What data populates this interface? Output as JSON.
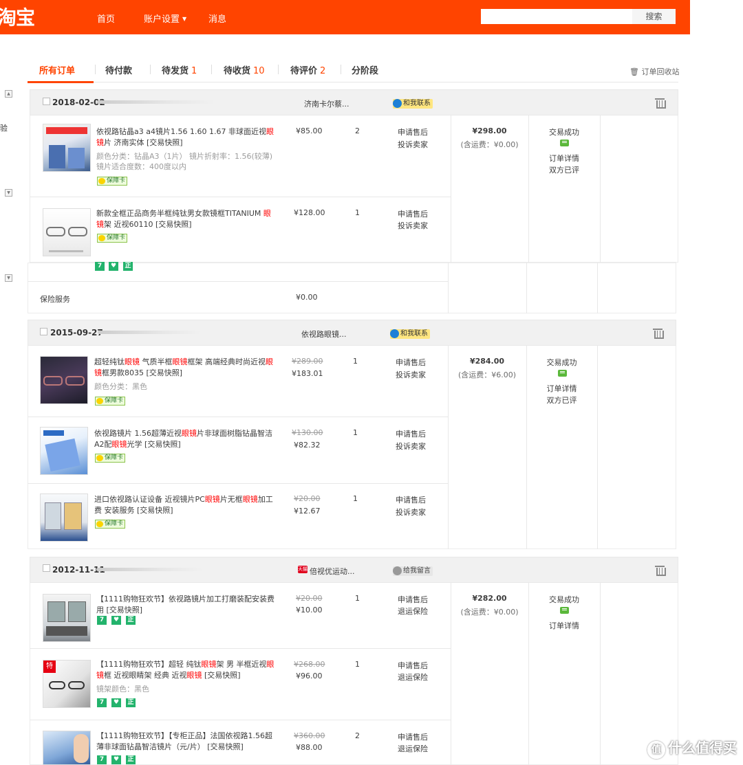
{
  "header": {
    "logo": "淘宝",
    "nav": [
      "首页",
      "账户设置",
      "消息"
    ],
    "search_placeholder": "",
    "search_button": "搜索"
  },
  "tabs": [
    {
      "label": "所有订单",
      "count": ""
    },
    {
      "label": "待付款",
      "count": ""
    },
    {
      "label": "待发货",
      "count": "1"
    },
    {
      "label": "待收货",
      "count": "10"
    },
    {
      "label": "待评价",
      "count": "2"
    },
    {
      "label": "分阶段",
      "count": ""
    }
  ],
  "recycle_bin": "订单回收站",
  "sidebar": {
    "text": "验"
  },
  "orders": [
    {
      "date": "2018-02-02",
      "shop": "济南卡尔蔡...",
      "contact": "和我联系",
      "total": "¥298.00",
      "shipping": "(含运费：¥0.00)",
      "status": [
        "交易成功",
        "订单详情",
        "双方已评"
      ],
      "items": [
        {
          "title_parts": [
            "依视路钻晶a3 a4镜片1.56 1.60 1.67 非球面近视",
            "眼镜",
            "片 济南实体 ",
            "[交易快照]"
          ],
          "meta": [
            "颜色分类：钻晶A3（1片）   镜片折射率：1.56(较薄)",
            "镜片适合度数：400度以内"
          ],
          "guarantee": "保障卡",
          "price_old": "",
          "price": "¥85.00",
          "qty": "2",
          "actions": [
            "申请售后",
            "投诉卖家"
          ]
        },
        {
          "title_parts": [
            "新款全框正品商务半框纯钛男女款镜框TITANIUM ",
            "眼镜",
            "架 近视60110 ",
            "[交易快照]"
          ],
          "meta": [],
          "guarantee": "保障卡",
          "price_old": "",
          "price": "¥128.00",
          "qty": "1",
          "actions": [
            "申请售后",
            "投诉卖家"
          ]
        }
      ],
      "badges": [
        "7",
        "♥",
        "正"
      ],
      "insurance_label": "保险服务",
      "insurance_price": "¥0.00"
    },
    {
      "date": "2015-09-27",
      "shop": "依视路眼镜...",
      "contact": "和我联系",
      "total": "¥284.00",
      "shipping": "(含运费：¥6.00)",
      "status": [
        "交易成功",
        "订单详情",
        "双方已评"
      ],
      "items": [
        {
          "title_parts": [
            "超轻纯钛",
            "眼镜",
            " 气质半框",
            "眼镜",
            "框架 高端经典时尚近视",
            "眼镜",
            "框男款8035 ",
            "[交易快照]"
          ],
          "meta": [
            "颜色分类：黑色"
          ],
          "guarantee": "保障卡",
          "price_old": "¥289.00",
          "price": "¥183.01",
          "qty": "1",
          "actions": [
            "申请售后",
            "投诉卖家"
          ]
        },
        {
          "title_parts": [
            "依视路镜片 1.56超薄近视",
            "眼镜",
            "片非球面树脂钻晶智洁A2配",
            "眼镜",
            "光学 ",
            "[交易快照]"
          ],
          "meta": [],
          "guarantee": "保障卡",
          "price_old": "¥130.00",
          "price": "¥82.32",
          "qty": "1",
          "actions": [
            "申请售后",
            "投诉卖家"
          ]
        },
        {
          "title_parts": [
            "进口依视路认证设备 近视镜片PC",
            "眼镜",
            "片无框",
            "眼镜",
            "加工费 安装服务 ",
            "[交易快照]"
          ],
          "meta": [],
          "guarantee": "保障卡",
          "price_old": "¥20.00",
          "price": "¥12.67",
          "qty": "1",
          "actions": [
            "申请售后",
            "投诉卖家"
          ]
        }
      ]
    },
    {
      "date": "2012-11-11",
      "shop": "倍视优运动...",
      "shop_tag": "天猫",
      "contact": "给我留言",
      "total": "¥282.00",
      "shipping": "(含运费：¥0.00)",
      "status": [
        "交易成功",
        "订单详情"
      ],
      "items": [
        {
          "title_parts": [
            "【1111购物狂欢节】依视路镜片加工打磨装配安装费用 ",
            "[交易快照]"
          ],
          "meta": [],
          "badges": [
            "7",
            "♥",
            "正"
          ],
          "price_old": "¥20.00",
          "price": "¥10.00",
          "qty": "1",
          "actions": [
            "申请售后",
            "退运保险"
          ]
        },
        {
          "title_parts": [
            "【1111购物狂欢节】超轻 纯钛",
            "眼镜",
            "架 男 半框近视",
            "眼镜",
            "框 近视眼睛架 经典 近视",
            "眼镜",
            " ",
            "[交易快照]"
          ],
          "meta": [
            "镜架颜色：黑色"
          ],
          "badges": [
            "7",
            "♥",
            "正"
          ],
          "price_old": "¥268.00",
          "price": "¥96.00",
          "qty": "1",
          "actions": [
            "申请售后",
            "退运保险"
          ]
        },
        {
          "title_parts": [
            "【1111购物狂欢节】【专柜正品】法国依视路1.56超薄非球面钻晶智洁镜片（元/片） ",
            "[交易快照]"
          ],
          "meta": [],
          "badges": [
            "7",
            "♥",
            "正"
          ],
          "price_old": "¥360.00",
          "price": "¥88.00",
          "qty": "2",
          "actions": [
            "申请售后",
            "退运保险"
          ]
        }
      ]
    }
  ],
  "watermark": "什么值得买",
  "watermark_glyph": "值",
  "colors": {
    "brand": "#ff4400",
    "highlight": "#ff0000",
    "badge_green": "#23b36c"
  }
}
